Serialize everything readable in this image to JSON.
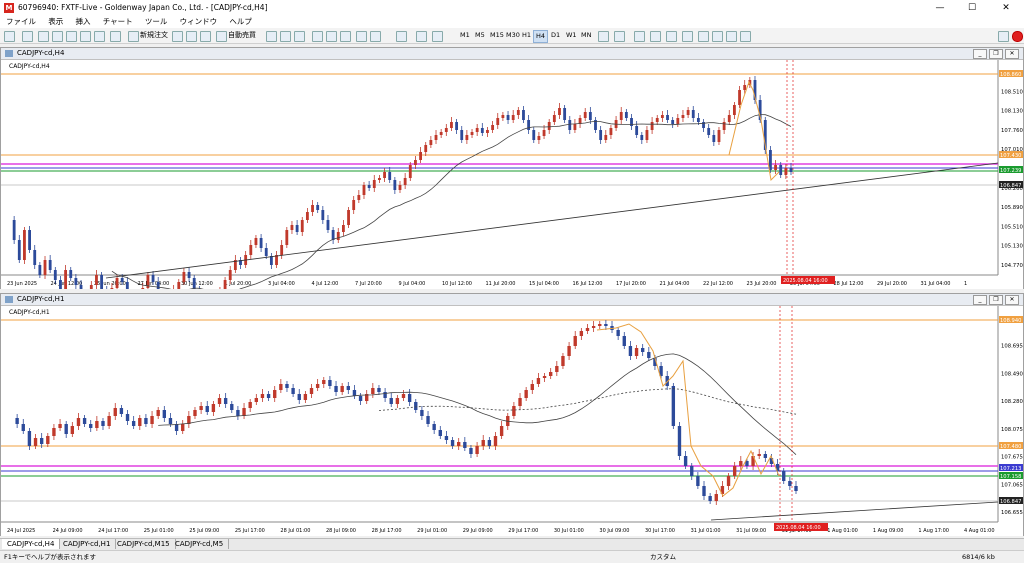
{
  "window": {
    "title": "60796940: FXTF-Live - Goldenway Japan Co., Ltd. - [CADJPY-cd,H4]",
    "minimize": "—",
    "maximize": "☐",
    "close": "✕"
  },
  "menu": [
    "ファイル",
    "表示",
    "挿入",
    "チャート",
    "ツール",
    "ウィンドウ",
    "ヘルプ"
  ],
  "toolbar": {
    "new_order": "新規注文",
    "auto_trade": "自動売買",
    "timeframes": [
      "M1",
      "M5",
      "M15",
      "M30",
      "H1",
      "H4",
      "D1",
      "W1",
      "MN"
    ],
    "active_timeframe": "H4"
  },
  "chart_h4": {
    "window_title": "CADJPY-cd,H4",
    "label": "CADJPY-cd,H4",
    "y_ticks": [
      "108.880",
      "108.510",
      "108.130",
      "107.760",
      "107.010",
      "106.640",
      "106.260",
      "105.890",
      "105.510",
      "105.130",
      "104.770"
    ],
    "price_tags": [
      {
        "text": "108.860",
        "color": "#f0a040"
      },
      {
        "text": "107.430",
        "color": "#f0a040"
      },
      {
        "text": "107.239",
        "color": "#1a9b2e"
      },
      {
        "text": "106.847",
        "color": "#222222"
      }
    ],
    "x_ticks": [
      "23 Jun 2025",
      "24 Jun 12:00",
      "25 Jun 20:00",
      "27 Jun 04:00",
      "30 Jun 12:00",
      "1 Jul 20:00",
      "3 Jul 04:00",
      "4 Jul 12:00",
      "7 Jul 20:00",
      "9 Jul 04:00",
      "10 Jul 12:00",
      "11 Jul 20:00",
      "15 Jul 04:00",
      "16 Jul 12:00",
      "17 Jul 20:00",
      "21 Jul 04:00",
      "22 Jul 12:00",
      "23 Jul 20:00",
      "25 Jul 04:00",
      "28 Jul 12:00",
      "29 Jul 20:00",
      "31 Jul 04:00",
      "1"
    ],
    "time_tag": "2025.08.04 16:00"
  },
  "chart_h1": {
    "window_title": "CADJPY-cd,H1",
    "label": "CADJPY-cd,H1",
    "y_ticks": [
      "108.900",
      "108.695",
      "108.490",
      "108.280",
      "108.075",
      "107.675",
      "107.065",
      "106.655"
    ],
    "price_tags": [
      {
        "text": "108.940",
        "color": "#f0a040"
      },
      {
        "text": "107.480",
        "color": "#f0a040"
      },
      {
        "text": "107.213",
        "color": "#3b3bd0"
      },
      {
        "text": "107.158",
        "color": "#1a9b2e"
      },
      {
        "text": "106.847",
        "color": "#222222"
      }
    ],
    "x_ticks": [
      "24 Jul 2025",
      "24 Jul 09:00",
      "24 Jul 17:00",
      "25 Jul 01:00",
      "25 Jul 09:00",
      "25 Jul 17:00",
      "28 Jul 01:00",
      "28 Jul 09:00",
      "28 Jul 17:00",
      "29 Jul 01:00",
      "29 Jul 09:00",
      "29 Jul 17:00",
      "30 Jul 01:00",
      "30 Jul 09:00",
      "30 Jul 17:00",
      "31 Jul 01:00",
      "31 Jul 09:00",
      "31 Jul 17:00",
      "1 Aug 01:00",
      "1 Aug 09:00",
      "1 Aug 17:00",
      "4 Aug 01:00"
    ],
    "time_tag": "2025.08.04 16:00"
  },
  "tabs": [
    "CADJPY-cd,H4",
    "CADJPY-cd,H1",
    "CADJPY-cd,M15",
    "CADJPY-cd,M5"
  ],
  "active_tab": "CADJPY-cd,H4",
  "status": {
    "help": "F1キーでヘルプが表示されます",
    "profile": "カスタム",
    "traffic": "6814/6 kb"
  },
  "colors": {
    "bull": "#c0392b",
    "bear": "#2c4a9a",
    "ma": "#444444",
    "zigzag": "#e8a040",
    "resistance": "#f0a040",
    "magenta": "#e040e0",
    "purple": "#3b3bd0",
    "green": "#1a9b2e",
    "red_marker": "#e02020"
  }
}
